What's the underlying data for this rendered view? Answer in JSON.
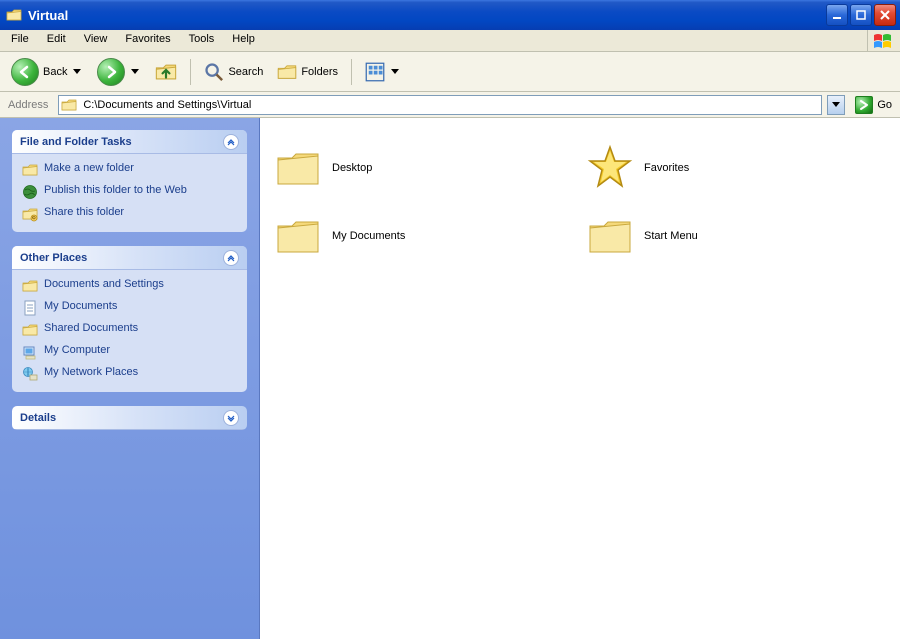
{
  "window": {
    "title": "Virtual"
  },
  "menus": [
    "File",
    "Edit",
    "View",
    "Favorites",
    "Tools",
    "Help"
  ],
  "toolbar": {
    "back": "Back",
    "search": "Search",
    "folders": "Folders"
  },
  "address": {
    "label": "Address",
    "path": "C:\\Documents and Settings\\Virtual",
    "go": "Go"
  },
  "tasks": {
    "file_folder": {
      "title": "File and Folder Tasks",
      "items": [
        "Make a new folder",
        "Publish this folder to the Web",
        "Share this folder"
      ]
    },
    "other_places": {
      "title": "Other Places",
      "items": [
        "Documents and Settings",
        "My Documents",
        "Shared Documents",
        "My Computer",
        "My Network Places"
      ]
    },
    "details": {
      "title": "Details"
    }
  },
  "files": [
    {
      "name": "Desktop",
      "icon": "folder"
    },
    {
      "name": "Favorites",
      "icon": "star"
    },
    {
      "name": "My Documents",
      "icon": "folder"
    },
    {
      "name": "Start Menu",
      "icon": "folder"
    }
  ]
}
